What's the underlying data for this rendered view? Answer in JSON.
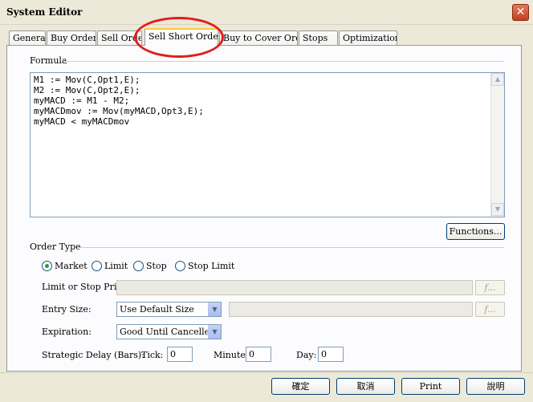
{
  "window": {
    "title": "System Editor",
    "close_symbol": "✕"
  },
  "tabs": [
    {
      "label": "General"
    },
    {
      "label": "Buy Order"
    },
    {
      "label": "Sell Order"
    },
    {
      "label": "Sell Short Order",
      "active": true
    },
    {
      "label": "Buy to Cover Order"
    },
    {
      "label": "Stops"
    },
    {
      "label": "Optimizations"
    }
  ],
  "formula": {
    "group_label": "Formula",
    "text": "M1 := Mov(C,Opt1,E);\nM2 := Mov(C,Opt2,E);\nmyMACD := M1 - M2;\nmyMACDmov := Mov(myMACD,Opt3,E);\nmyMACD < myMACDmov",
    "functions_button": "Functions..."
  },
  "order_type": {
    "group_label": "Order Type",
    "options": [
      {
        "label": "Market",
        "selected": true
      },
      {
        "label": "Limit",
        "selected": false
      },
      {
        "label": "Stop",
        "selected": false
      },
      {
        "label": "Stop Limit",
        "selected": false
      }
    ]
  },
  "fields": {
    "limit_or_stop_price": {
      "label": "Limit or Stop Price:",
      "value": "",
      "fx": "f..."
    },
    "entry_size": {
      "label": "Entry Size:",
      "value": "Use Default Size",
      "extra_value": "",
      "fx": "f..."
    },
    "expiration": {
      "label": "Expiration:",
      "value": "Good Until Cancelled"
    },
    "strategic_delay": {
      "label": "Strategic Delay (Bars):",
      "tick_label": "Tick:",
      "tick_value": "0",
      "minute_label": "Minute:",
      "minute_value": "0",
      "day_label": "Day:",
      "day_value": "0"
    }
  },
  "footer": {
    "ok": "確定",
    "cancel": "取消",
    "print": "Print",
    "help": "說明"
  },
  "colors": {
    "highlight_ellipse": "#e01e1e",
    "active_tab_accent": "#ffc83c"
  }
}
